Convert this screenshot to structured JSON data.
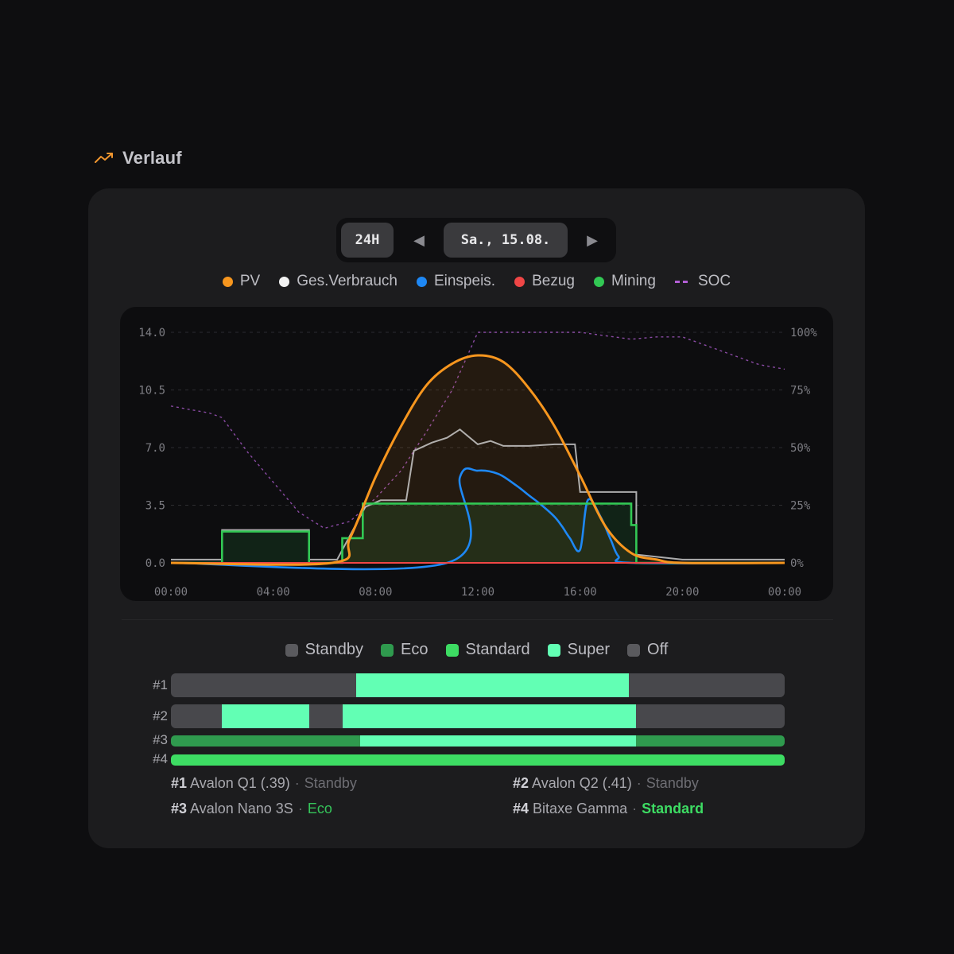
{
  "section": {
    "title": "Verlauf",
    "icon": "trending-up-icon",
    "accent": "#f0962f"
  },
  "nav": {
    "range_label": "24H",
    "prev_label": "◀",
    "date_label": "Sa., 15.08.",
    "next_label": "▶"
  },
  "legend": [
    {
      "label": "PV",
      "color": "#f7961e",
      "style": "dot"
    },
    {
      "label": "Ges.Verbrauch",
      "color": "#f2f2f2",
      "style": "dot"
    },
    {
      "label": "Einspeis.",
      "color": "#1e88f5",
      "style": "dot"
    },
    {
      "label": "Bezug",
      "color": "#ef4646",
      "style": "dot"
    },
    {
      "label": "Mining",
      "color": "#32c854",
      "style": "dot"
    },
    {
      "label": "SOC",
      "color": "#b35fd6",
      "style": "dash"
    }
  ],
  "chart_data": {
    "type": "line",
    "x_ticks": [
      "00:00",
      "04:00",
      "08:00",
      "12:00",
      "16:00",
      "20:00",
      "00:00"
    ],
    "y_left_ticks": [
      "14.0",
      "10.5",
      "7.0",
      "3.5",
      "0.0"
    ],
    "y_right_ticks": [
      "100%",
      "75%",
      "50%",
      "25%",
      "0%"
    ],
    "ylim": [
      0,
      14
    ],
    "grid": true,
    "series": [
      {
        "name": "PV",
        "color": "#f7961e",
        "x": [
          0,
          6.3,
          7,
          8,
          9,
          10,
          11,
          12,
          13,
          14,
          15,
          16,
          17,
          18,
          19,
          20,
          24
        ],
        "y": [
          0,
          0,
          1.5,
          5.2,
          8.3,
          10.8,
          12.1,
          12.6,
          12.2,
          10.6,
          8.3,
          5.3,
          2.2,
          0.6,
          0.2,
          0,
          0
        ]
      },
      {
        "name": "Ges.Verbrauch",
        "color": "#d4d4d4",
        "x": [
          0,
          2,
          2,
          5.4,
          5.4,
          6.5,
          7.6,
          8.2,
          9.2,
          9.5,
          10.2,
          10.8,
          11.3,
          12,
          12.5,
          13,
          14,
          15,
          15.8,
          16,
          18.2,
          18.2,
          20,
          24
        ],
        "y": [
          0.2,
          0.2,
          2.0,
          2.0,
          0.2,
          0.2,
          3.4,
          3.8,
          3.8,
          6.8,
          7.3,
          7.6,
          8.1,
          7.2,
          7.4,
          7.1,
          7.1,
          7.2,
          7.2,
          4.3,
          4.3,
          0.5,
          0.2,
          0.2
        ]
      },
      {
        "name": "Einspeis.",
        "color": "#1e88f5",
        "x": [
          0,
          10.8,
          11.3,
          12,
          12.8,
          13.5,
          14,
          14.5,
          15,
          15.3,
          15.6,
          16,
          16.3,
          16.8,
          17.2,
          17.5,
          18,
          24
        ],
        "y": [
          0,
          0,
          5.2,
          5.6,
          5.4,
          4.7,
          4.1,
          3.5,
          2.8,
          2.2,
          1.5,
          0.8,
          3.8,
          2.8,
          1.4,
          0.4,
          0,
          0
        ]
      },
      {
        "name": "Bezug",
        "color": "#ef4646",
        "x": [
          0,
          24
        ],
        "y": [
          0,
          0
        ]
      },
      {
        "name": "Mining",
        "color": "#32c854",
        "x": [
          0,
          2,
          2,
          5.4,
          5.4,
          6.7,
          6.7,
          7.5,
          7.5,
          18,
          18,
          18.2,
          18.2,
          24
        ],
        "y": [
          0,
          0,
          1.9,
          1.9,
          0,
          0,
          1.5,
          1.5,
          3.6,
          3.6,
          2.3,
          2.3,
          0,
          0
        ]
      },
      {
        "name": "SOC",
        "color": "#b35fd6",
        "x": [
          0,
          1.5,
          2,
          3,
          4,
          5,
          6,
          7,
          8,
          9,
          10,
          11,
          12,
          13,
          14,
          16,
          18,
          19,
          20,
          21,
          22,
          23,
          24
        ],
        "y": [
          68,
          65,
          63,
          48,
          35,
          22,
          15,
          18,
          28,
          40,
          57,
          75,
          100,
          100,
          100,
          100,
          97,
          98,
          98,
          94,
          90,
          86,
          84
        ]
      }
    ]
  },
  "mining_legend": [
    {
      "label": "Standby",
      "color": "#5a5a5e"
    },
    {
      "label": "Eco",
      "color": "#2f9a4e"
    },
    {
      "label": "Standard",
      "color": "#3ddc63"
    },
    {
      "label": "Super",
      "color": "#62ffb4"
    },
    {
      "label": "Off",
      "color": "#5a5a5e"
    }
  ],
  "mining_rows": [
    {
      "label": "#1",
      "segments": [
        {
          "state": "Standby",
          "from": 0,
          "to": 7.25
        },
        {
          "state": "Super",
          "from": 7.25,
          "to": 17.9
        },
        {
          "state": "Standby",
          "from": 17.9,
          "to": 24
        }
      ]
    },
    {
      "label": "#2",
      "segments": [
        {
          "state": "Standby",
          "from": 0,
          "to": 2
        },
        {
          "state": "Super",
          "from": 2,
          "to": 5.4
        },
        {
          "state": "Standby",
          "from": 5.4,
          "to": 6.7
        },
        {
          "state": "Super",
          "from": 6.7,
          "to": 18.2
        },
        {
          "state": "Standby",
          "from": 18.2,
          "to": 24
        }
      ]
    },
    {
      "label": "#3",
      "segments": [
        {
          "state": "Eco",
          "from": 0,
          "to": 7.4
        },
        {
          "state": "Super",
          "from": 7.4,
          "to": 18.2
        },
        {
          "state": "Eco",
          "from": 18.2,
          "to": 24
        }
      ]
    },
    {
      "label": "#4",
      "segments": [
        {
          "state": "Standard",
          "from": 0,
          "to": 24
        }
      ]
    }
  ],
  "devices": [
    {
      "id": "#1",
      "name": "Avalon Q1 (.39)",
      "status": "Standby"
    },
    {
      "id": "#2",
      "name": "Avalon Q2 (.41)",
      "status": "Standby"
    },
    {
      "id": "#3",
      "name": "Avalon Nano 3S",
      "status": "Eco"
    },
    {
      "id": "#4",
      "name": "Bitaxe Gamma",
      "status": "Standard"
    }
  ]
}
